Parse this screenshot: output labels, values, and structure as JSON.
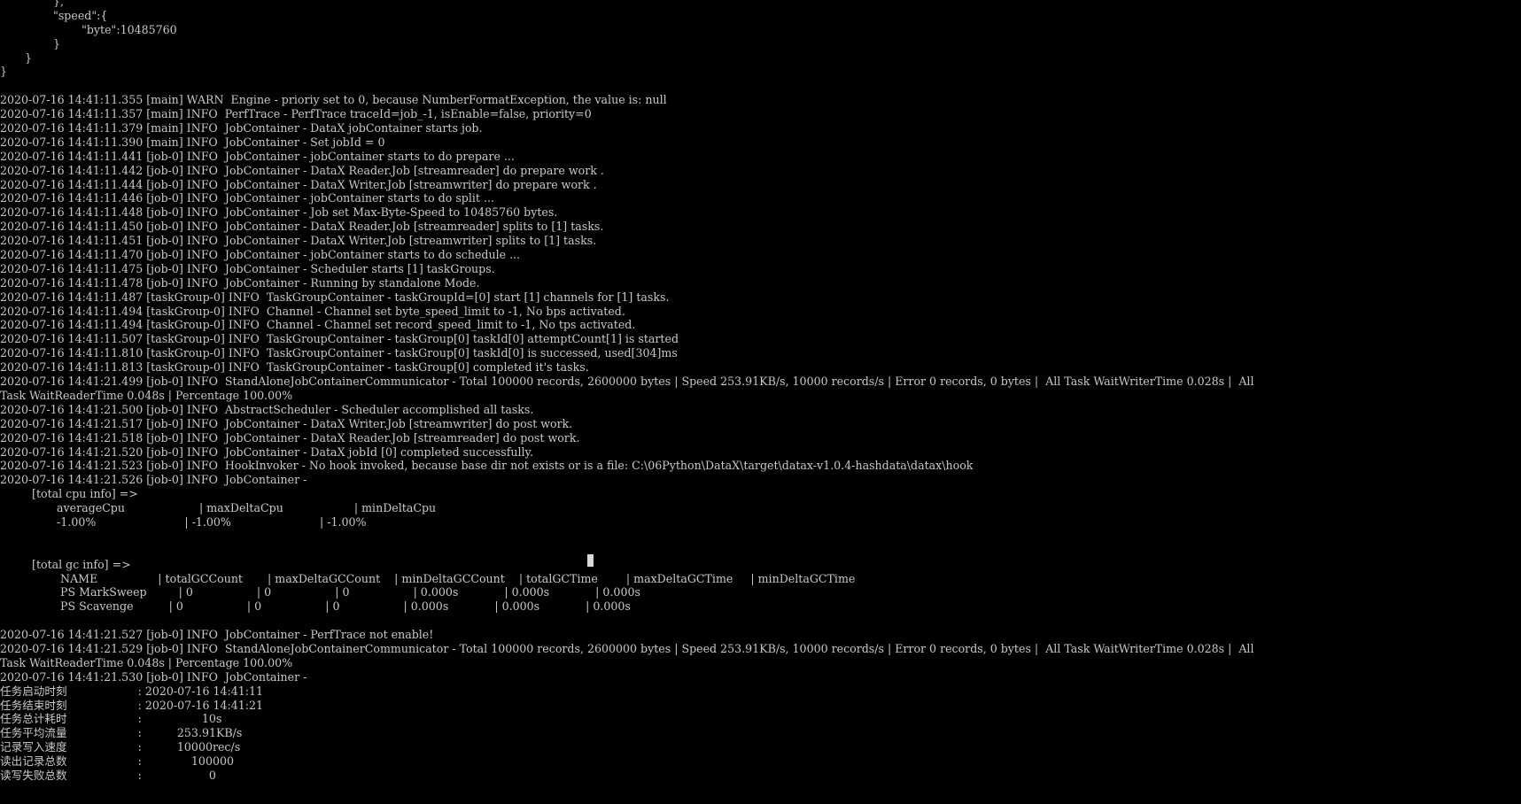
{
  "terminal": {
    "colors": {
      "background": "#000000",
      "text": "#c8c8c8",
      "cursor": "#d8d8d8"
    },
    "lines": [
      "               },",
      "               \"speed\":{",
      "                       \"byte\":10485760",
      "               }",
      "       }",
      "}",
      "",
      "2020-07-16 14:41:11.355 [main] WARN  Engine - prioriy set to 0, because NumberFormatException, the value is: null",
      "2020-07-16 14:41:11.357 [main] INFO  PerfTrace - PerfTrace traceId=job_-1, isEnable=false, priority=0",
      "2020-07-16 14:41:11.379 [main] INFO  JobContainer - DataX jobContainer starts job.",
      "2020-07-16 14:41:11.390 [main] INFO  JobContainer - Set jobId = 0",
      "2020-07-16 14:41:11.441 [job-0] INFO  JobContainer - jobContainer starts to do prepare ...",
      "2020-07-16 14:41:11.442 [job-0] INFO  JobContainer - DataX Reader.Job [streamreader] do prepare work .",
      "2020-07-16 14:41:11.444 [job-0] INFO  JobContainer - DataX Writer.Job [streamwriter] do prepare work .",
      "2020-07-16 14:41:11.446 [job-0] INFO  JobContainer - jobContainer starts to do split ...",
      "2020-07-16 14:41:11.448 [job-0] INFO  JobContainer - Job set Max-Byte-Speed to 10485760 bytes.",
      "2020-07-16 14:41:11.450 [job-0] INFO  JobContainer - DataX Reader.Job [streamreader] splits to [1] tasks.",
      "2020-07-16 14:41:11.451 [job-0] INFO  JobContainer - DataX Writer.Job [streamwriter] splits to [1] tasks.",
      "2020-07-16 14:41:11.470 [job-0] INFO  JobContainer - jobContainer starts to do schedule ...",
      "2020-07-16 14:41:11.475 [job-0] INFO  JobContainer - Scheduler starts [1] taskGroups.",
      "2020-07-16 14:41:11.478 [job-0] INFO  JobContainer - Running by standalone Mode.",
      "2020-07-16 14:41:11.487 [taskGroup-0] INFO  TaskGroupContainer - taskGroupId=[0] start [1] channels for [1] tasks.",
      "2020-07-16 14:41:11.494 [taskGroup-0] INFO  Channel - Channel set byte_speed_limit to -1, No bps activated.",
      "2020-07-16 14:41:11.494 [taskGroup-0] INFO  Channel - Channel set record_speed_limit to -1, No tps activated.",
      "2020-07-16 14:41:11.507 [taskGroup-0] INFO  TaskGroupContainer - taskGroup[0] taskId[0] attemptCount[1] is started",
      "2020-07-16 14:41:11.810 [taskGroup-0] INFO  TaskGroupContainer - taskGroup[0] taskId[0] is successed, used[304]ms",
      "2020-07-16 14:41:11.813 [taskGroup-0] INFO  TaskGroupContainer - taskGroup[0] completed it's tasks.",
      "2020-07-16 14:41:21.499 [job-0] INFO  StandAloneJobContainerCommunicator - Total 100000 records, 2600000 bytes | Speed 253.91KB/s, 10000 records/s | Error 0 records, 0 bytes |  All Task WaitWriterTime 0.028s |  All",
      "Task WaitReaderTime 0.048s | Percentage 100.00%",
      "2020-07-16 14:41:21.500 [job-0] INFO  AbstractScheduler - Scheduler accomplished all tasks.",
      "2020-07-16 14:41:21.517 [job-0] INFO  JobContainer - DataX Writer.Job [streamwriter] do post work.",
      "2020-07-16 14:41:21.518 [job-0] INFO  JobContainer - DataX Reader.Job [streamreader] do post work.",
      "2020-07-16 14:41:21.520 [job-0] INFO  JobContainer - DataX jobId [0] completed successfully.",
      "2020-07-16 14:41:21.523 [job-0] INFO  HookInvoker - No hook invoked, because base dir not exists or is a file: C:\\06Python\\DataX\\target\\datax-v1.0.4-hashdata\\datax\\hook",
      "2020-07-16 14:41:21.526 [job-0] INFO  JobContainer -",
      "         [total cpu info] =>",
      "                averageCpu                     | maxDeltaCpu                    | minDeltaCpu",
      "                -1.00%                         | -1.00%                         | -1.00%",
      "",
      "",
      "         [total gc info] =>",
      "                 NAME                 | totalGCCount       | maxDeltaGCCount    | minDeltaGCCount    | totalGCTime        | maxDeltaGCTime     | minDeltaGCTime",
      "                 PS MarkSweep         | 0                  | 0                  | 0                  | 0.000s             | 0.000s             | 0.000s",
      "                 PS Scavenge          | 0                  | 0                  | 0                  | 0.000s             | 0.000s             | 0.000s",
      "",
      "2020-07-16 14:41:21.527 [job-0] INFO  JobContainer - PerfTrace not enable!",
      "2020-07-16 14:41:21.529 [job-0] INFO  StandAloneJobContainerCommunicator - Total 100000 records, 2600000 bytes | Speed 253.91KB/s, 10000 records/s | Error 0 records, 0 bytes |  All Task WaitWriterTime 0.028s |  All",
      "Task WaitReaderTime 0.048s | Percentage 100.00%",
      "2020-07-16 14:41:21.530 [job-0] INFO  JobContainer -",
      "任务启动时刻                    : 2020-07-16 14:41:11",
      "任务结束时刻                    : 2020-07-16 14:41:21",
      "任务总计耗时                    :                 10s",
      "任务平均流量                    :          253.91KB/s",
      "记录写入速度                    :          10000rec/s",
      "读出记录总数                    :              100000",
      "读写失败总数                    :                   0"
    ]
  }
}
